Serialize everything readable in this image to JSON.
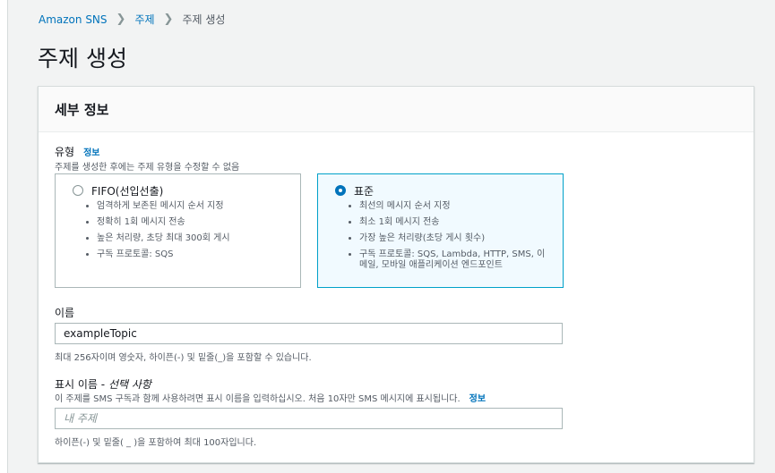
{
  "breadcrumb": {
    "items": [
      "Amazon SNS",
      "주제"
    ],
    "current": "주제 생성"
  },
  "page": {
    "title": "주제 생성"
  },
  "panel": {
    "title": "세부 정보"
  },
  "type_field": {
    "label": "유형",
    "info": "정보",
    "description": "주제를 생성한 후에는 주제 유형을 수정할 수 없음",
    "options": [
      {
        "title": "FIFO(선입선출)",
        "selected": false,
        "bullets": [
          "엄격하게 보존된 메시지 순서 지정",
          "정확히 1회 메시지 전송",
          "높은 처리량, 초당 최대 300회 게시",
          "구독 프로토콜: SQS"
        ]
      },
      {
        "title": "표준",
        "selected": true,
        "bullets": [
          "최선의 메시지 순서 지정",
          "최소 1회 메시지 전송",
          "가장 높은 처리량(초당 게시 횟수)",
          "구독 프로토콜: SQS, Lambda, HTTP, SMS, 이메일, 모바일 애플리케이션 엔드포인트"
        ]
      }
    ]
  },
  "name_field": {
    "label": "이름",
    "value": "exampleTopic",
    "hint": "최대 256자이며 영숫자, 하이픈(-) 및 밑줄(_)을 포함할 수 있습니다."
  },
  "display_name_field": {
    "label": "표시 이름 - ",
    "label_optional": "선택 사항",
    "description": "이 주제를 SMS 구독과 함께 사용하려면 표시 이름을 입력하십시오. 처음 10자만 SMS 메시지에 표시됩니다.",
    "info": "정보",
    "placeholder": "내 주제",
    "hint": "하이픈(-) 및 밑줄( _ )을 포함하여 최대 100자입니다."
  },
  "colors": {
    "link": "#0073bb",
    "selected_border": "#00a1c9",
    "selected_bg": "#f1faff"
  }
}
